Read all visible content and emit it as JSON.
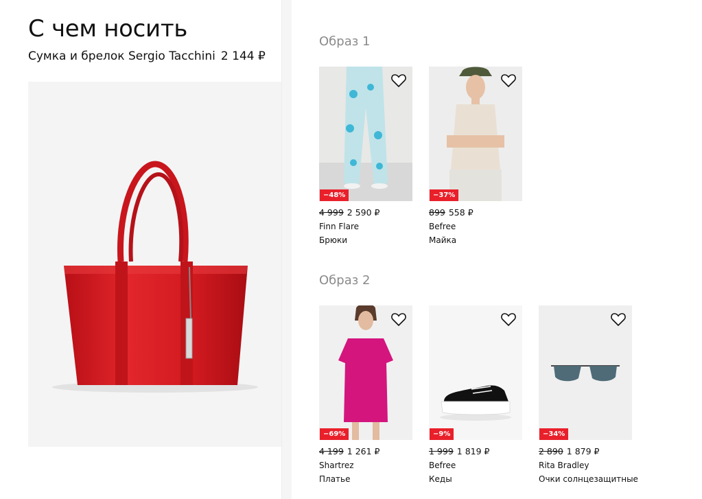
{
  "header": {
    "title": "С чем носить",
    "product_name": "Сумка и брелок Sergio Tacchini",
    "product_price": "2 144 ₽"
  },
  "looks": [
    {
      "title": "Образ 1",
      "items": [
        {
          "discount": "−48%",
          "old_price": "4 999",
          "price": "2 590 ₽",
          "brand": "Finn Flare",
          "category": "Брюки",
          "icon": "trousers-photo"
        },
        {
          "discount": "−37%",
          "old_price": "899",
          "price": "558 ₽",
          "brand": "Befree",
          "category": "Майка",
          "icon": "tank-top-photo"
        }
      ]
    },
    {
      "title": "Образ 2",
      "items": [
        {
          "discount": "−69%",
          "old_price": "4 199",
          "price": "1 261 ₽",
          "brand": "Shartrez",
          "category": "Платье",
          "icon": "dress-photo"
        },
        {
          "discount": "−9%",
          "old_price": "1 999",
          "price": "1 819 ₽",
          "brand": "Befree",
          "category": "Кеды",
          "icon": "sneaker-photo"
        },
        {
          "discount": "−34%",
          "old_price": "2 890",
          "price": "1 879 ₽",
          "brand": "Rita Bradley",
          "category": "Очки солнцезащитные",
          "icon": "sunglasses-photo"
        }
      ]
    }
  ],
  "colors": {
    "discount_badge": "#e9202a",
    "section_title": "#8a8a8a",
    "bag_red": "#d61b1f"
  }
}
